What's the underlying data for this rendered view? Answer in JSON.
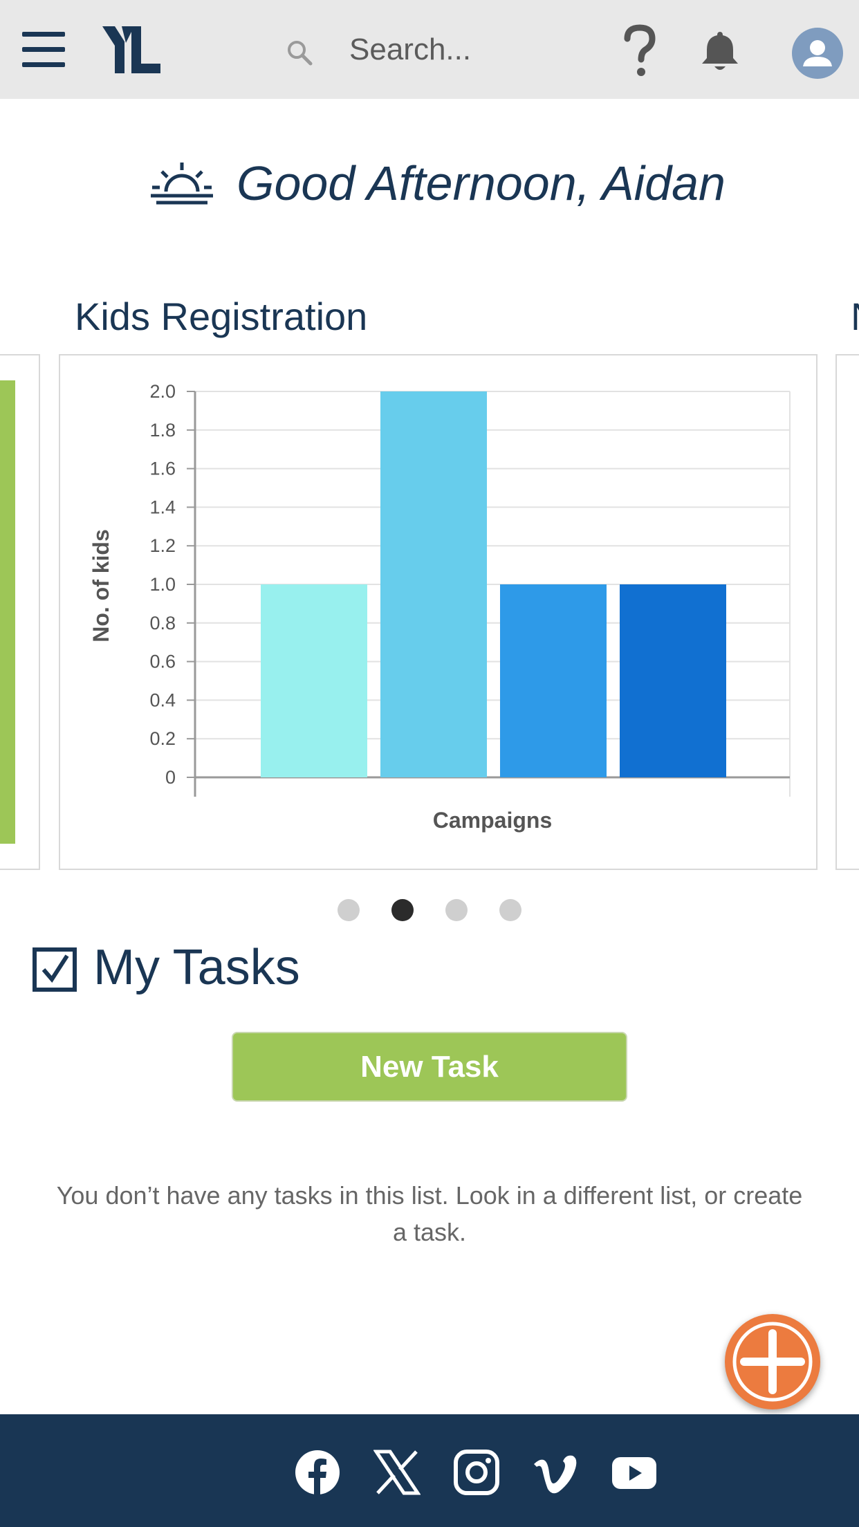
{
  "header": {
    "search_placeholder": "Search...",
    "help_label": "?"
  },
  "greeting": {
    "text": "Good Afternoon, Aidan"
  },
  "carousel": {
    "card_title": "Kids Registration",
    "next_title_peek": "N",
    "active_index": 1,
    "count": 4
  },
  "chart_data": {
    "type": "bar",
    "categories": [
      "",
      "",
      "",
      ""
    ],
    "values": [
      1,
      2,
      1,
      1
    ],
    "colors": [
      "#98f0ee",
      "#67cdec",
      "#2e9ae8",
      "#1170d1"
    ],
    "xlabel": "Campaigns",
    "ylabel": "No. of kids",
    "ylim": [
      0,
      2.0
    ],
    "yticks": [
      "0",
      "0.2",
      "0.4",
      "0.6",
      "0.8",
      "1.0",
      "1.2",
      "1.4",
      "1.6",
      "1.8",
      "2.0"
    ],
    "grid": true
  },
  "tasks": {
    "title": "My Tasks",
    "new_task_label": "New Task",
    "empty_message": "You don’t have any tasks in this list. Look in a different list, or create a task."
  },
  "footer": {
    "social": [
      "facebook-icon",
      "x-icon",
      "instagram-icon",
      "vimeo-icon",
      "youtube-icon"
    ]
  },
  "colors": {
    "header_bg": "#e8e8e8",
    "navy": "#1a3654",
    "green": "#9dc657",
    "orange": "#ec7b3f",
    "footer_bg": "#193654"
  }
}
